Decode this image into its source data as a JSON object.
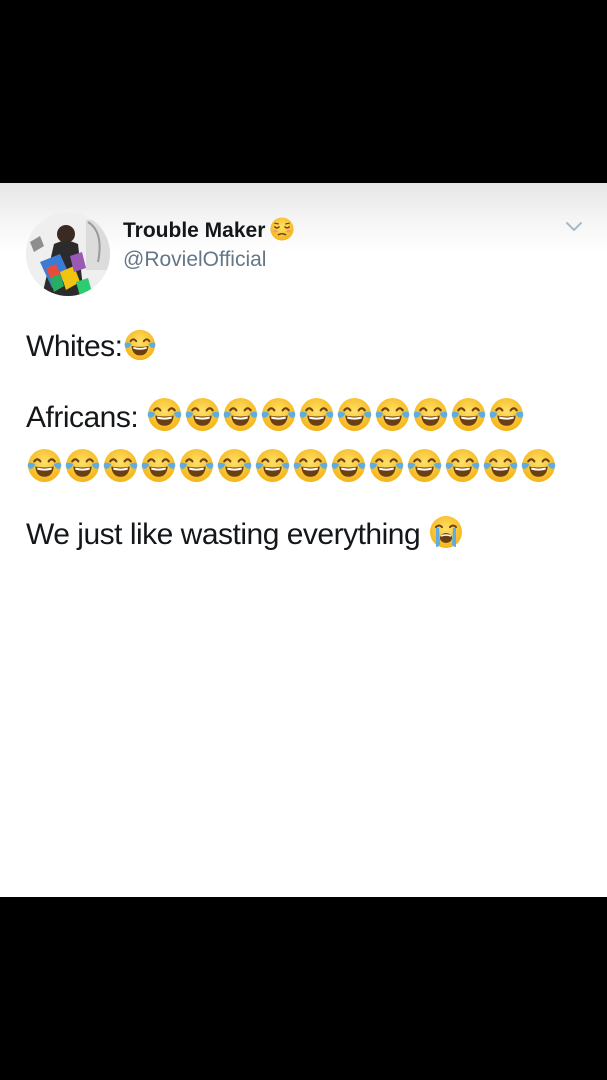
{
  "tweet": {
    "author_name": "Trouble Maker",
    "author_handle": "@RovielOfficial",
    "author_name_emoji": "relieved-face",
    "line1_text": "Whites:",
    "line1_emoji": "face-with-tears-of-joy",
    "line1_emoji_count": 1,
    "line2_text": "Africans: ",
    "line2_emoji": "face-with-tears-of-joy",
    "line2_emoji_count": 10,
    "line3_emoji": "face-with-tears-of-joy",
    "line3_emoji_count": 14,
    "line4_text": "We just like wasting everything ",
    "line4_emoji": "loudly-crying-face"
  },
  "colors": {
    "text": "#14171a",
    "handle": "#657786",
    "chevron": "#aab8c2",
    "emoji_face": "#f9c22b"
  }
}
